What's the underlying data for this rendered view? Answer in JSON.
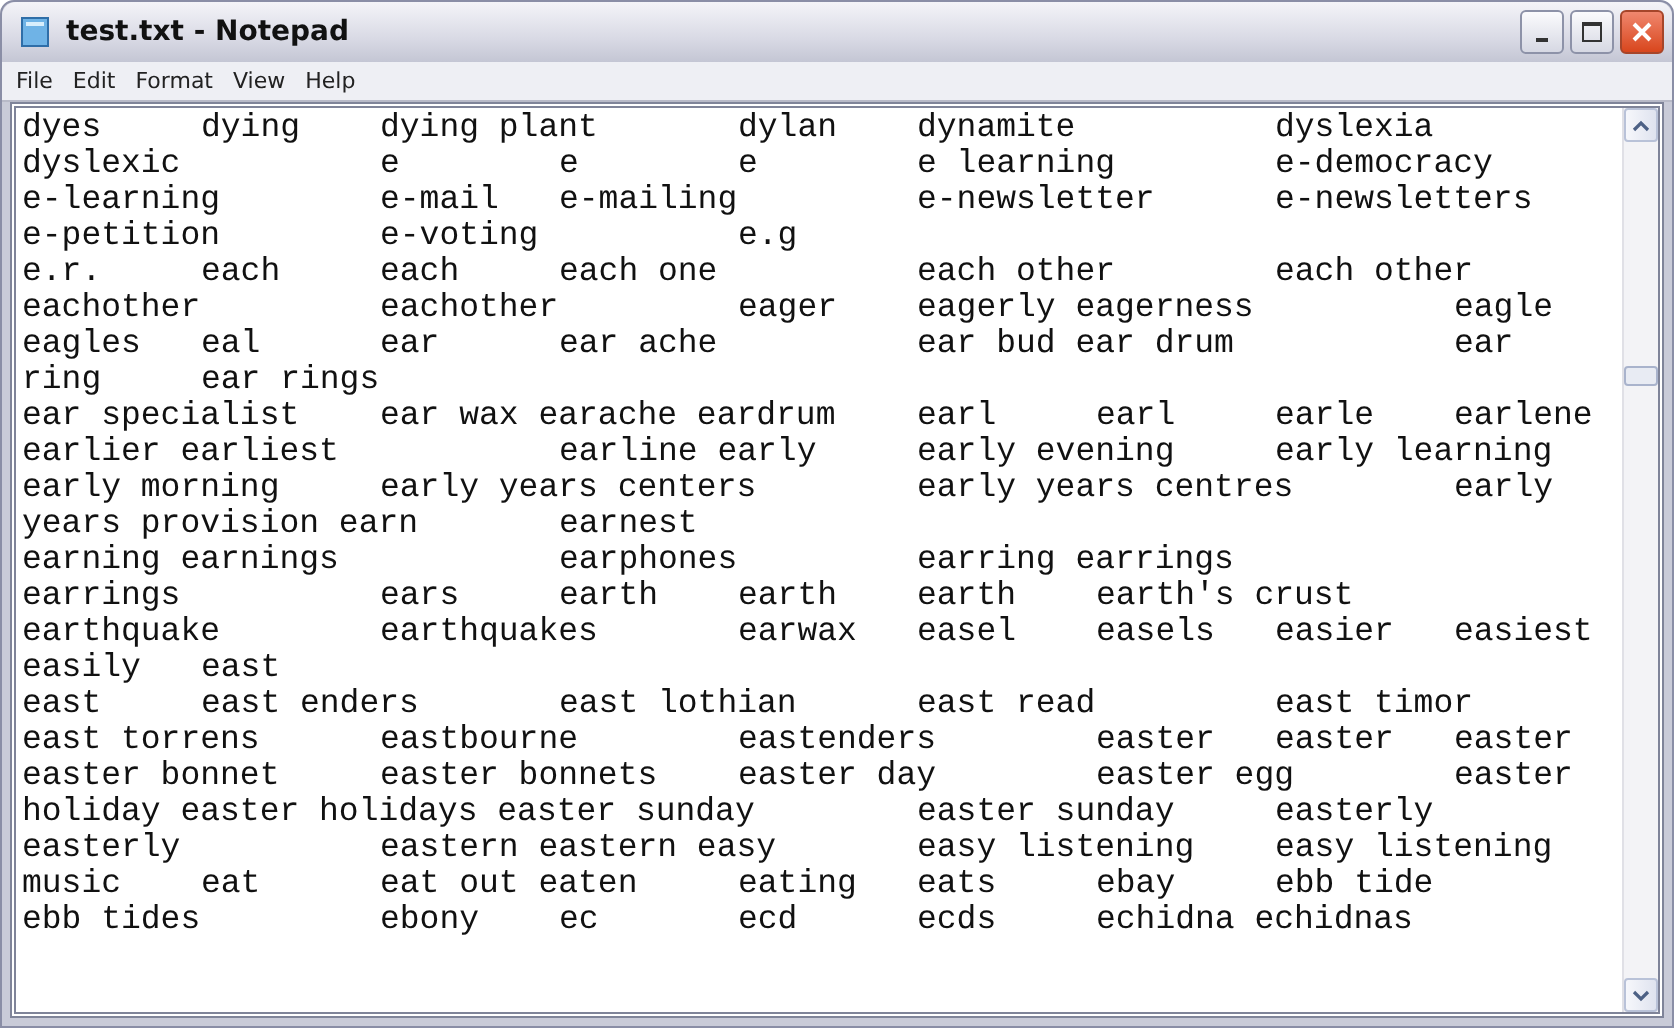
{
  "window": {
    "title": "test.txt - Notepad"
  },
  "menu": [
    {
      "label": "File"
    },
    {
      "label": "Edit"
    },
    {
      "label": "Format"
    },
    {
      "label": "View"
    },
    {
      "label": "Help"
    }
  ],
  "text_lines": [
    "dyes\tdying\tdying plant\tdylan\tdynamite\t\tdyslexia",
    "dyslexic\t\te\te\te\te learning\te-democracy",
    "e-learning\te-mail\te-mailing\te-newsletter\te-newsletters",
    "e-petition\te-voting\t\te.g",
    "e.r.\teach\teach\teach one\t\teach other\teach other",
    "eachother\teachother\teager\teagerly eagerness\t\teagle",
    "eagles\teal\tear\tear ache\t\tear bud ear drum\t\tear",
    "ring\tear rings",
    "ear specialist\tear wax earache eardrum\tearl\tearl\tearle\tearlene",
    "earlier earliest\t\tearline early\tearly evening\tearly learning",
    "early morning\tearly years centers\tearly years centres\tearly",
    "years provision earn\tearnest",
    "earning earnings\t\tearphones\tearring earrings",
    "earrings\t\tears\tearth\tearth\tearth\tearth's crust",
    "earthquake\tearthquakes\tearwax\teasel\teasels\teasier\teasiest",
    "easily\teast",
    "east\teast enders\teast lothian\teast read\teast timor",
    "east torrens\teastbourne\teastenders\teaster\teaster\teaster",
    "easter bonnet\teaster bonnets\teaster day\teaster egg\teaster",
    "holiday easter holidays easter sunday\teaster sunday\teasterly",
    "easterly\t\teastern eastern easy\teasy listening\teasy listening",
    "music\teat\teat out eaten\teating\teats\tebay\tebb tide",
    "ebb tides\tebony\tec\tecd\tecds\techidna echidnas"
  ]
}
